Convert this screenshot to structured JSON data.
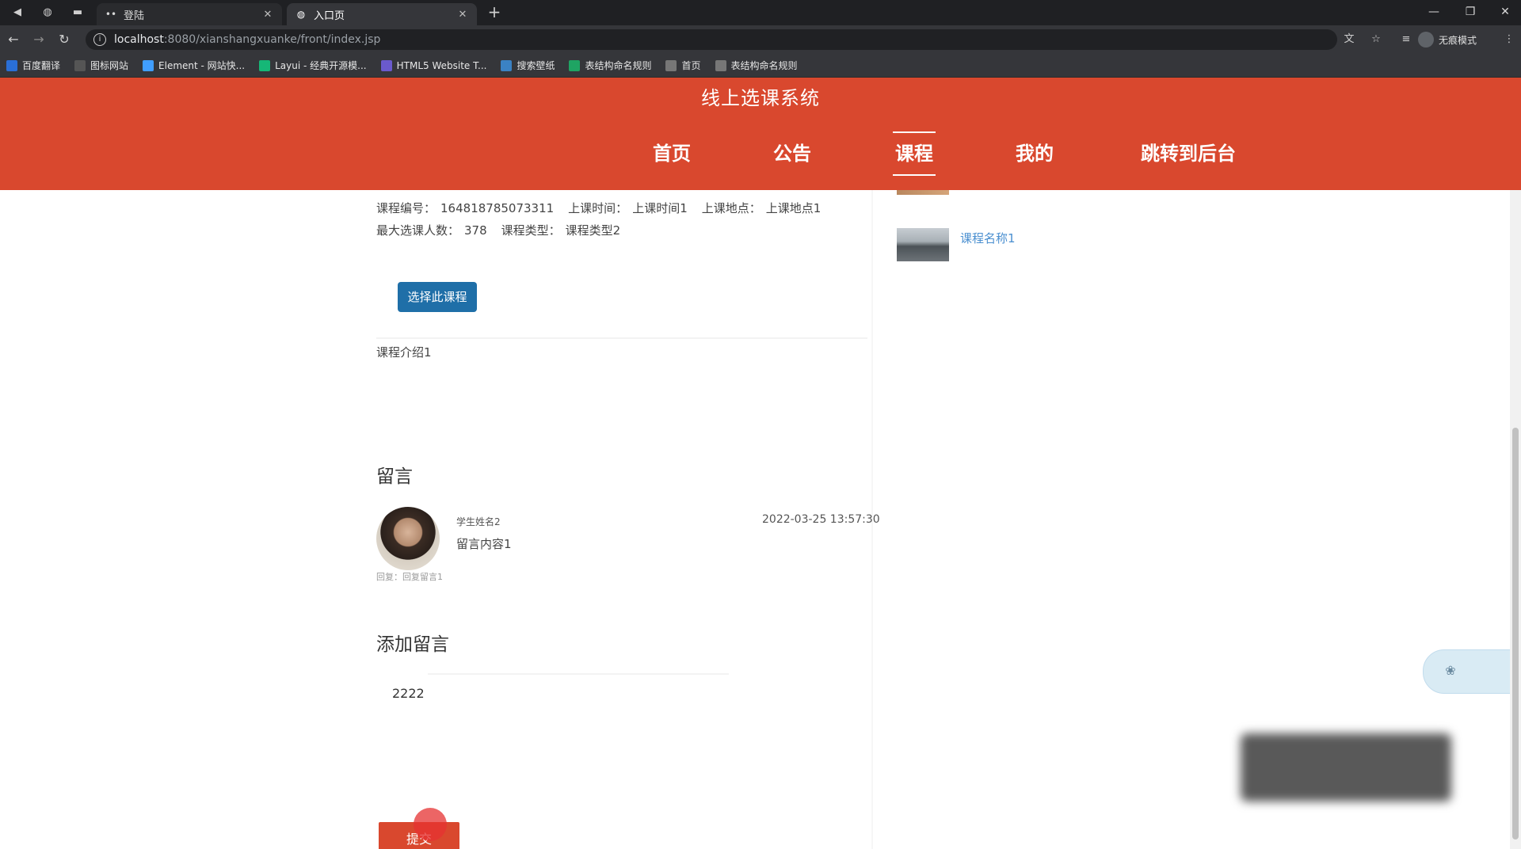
{
  "browser": {
    "tabs": [
      {
        "title": "登陆",
        "active": false,
        "favicon": "dots-icon"
      },
      {
        "title": "入口页",
        "active": true,
        "favicon": "globe-icon"
      }
    ],
    "new_tab_label": "+",
    "url": {
      "host": "localhost",
      "path": ":8080/xianshangxuanke/front/index.jsp"
    },
    "profile_label": "无痕模式",
    "bookmarks": [
      {
        "label": "百度翻译",
        "icon": "translate-icon",
        "color": "#2a6fd6"
      },
      {
        "label": "图标网站",
        "icon": "flag-icon",
        "color": "#555555"
      },
      {
        "label": "Element - 网站快...",
        "icon": "element-icon",
        "color": "#409eff"
      },
      {
        "label": "Layui - 经典开源模...",
        "icon": "layui-icon",
        "color": "#16b777"
      },
      {
        "label": "HTML5 Website T...",
        "icon": "html5-icon",
        "color": "#6a5acd"
      },
      {
        "label": "搜索壁纸",
        "icon": "wallpaper-icon",
        "color": "#3b82c4"
      },
      {
        "label": "表结构命名规则",
        "icon": "sheet-icon",
        "color": "#1fa463"
      },
      {
        "label": "首页",
        "icon": "globe-icon",
        "color": "#777777"
      },
      {
        "label": "表结构命名规则",
        "icon": "globe-icon",
        "color": "#777777"
      }
    ]
  },
  "site": {
    "title": "线上选课系统",
    "nav": [
      {
        "label": "首页",
        "active": false
      },
      {
        "label": "公告",
        "active": false
      },
      {
        "label": "课程",
        "active": true
      },
      {
        "label": "我的",
        "active": false
      },
      {
        "label": "跳转到后台",
        "active": false
      }
    ],
    "colors": {
      "header": "#d9482e",
      "select_button": "#1f6fa8",
      "link": "#4a8fd0"
    }
  },
  "course": {
    "code_label": "课程编号：",
    "code_value": "1648187850733​11",
    "time_label": "上课时间：",
    "time_value": "上课时间1",
    "place_label": "上课地点：",
    "place_value": "上课地点1",
    "max_label": "最大选课人数：",
    "max_value": "378",
    "type_label": "课程类型：",
    "type_value": "课程类型2",
    "select_button": "选择此课程",
    "intro": "课程介绍1"
  },
  "comments": {
    "section_title": "留言",
    "items": [
      {
        "author": "学生姓名2",
        "time": "2022-03-25 13:57:30",
        "content": "留言内容1",
        "reply": "回复：回复留言1"
      }
    ]
  },
  "add_comment": {
    "section_title": "添加留言",
    "input_value": "2222",
    "submit_label": "提交"
  },
  "sidebar": {
    "items": [
      {
        "title": "课程名称1"
      }
    ]
  }
}
